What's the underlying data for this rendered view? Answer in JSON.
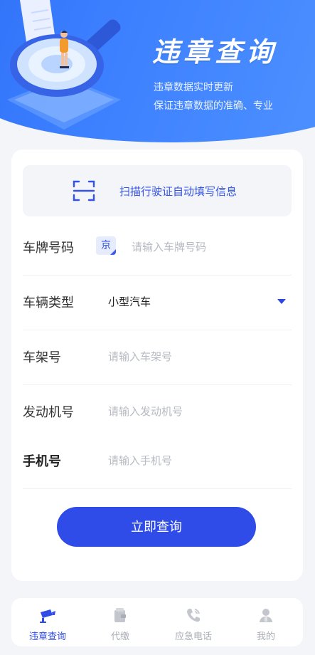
{
  "banner": {
    "title": "违章查询",
    "subtitle_line1": "违章数据实时更新",
    "subtitle_line2": "保证违章数据的准确、专业"
  },
  "scan": {
    "label": "扫描行驶证自动填写信息",
    "icon": "scan-icon"
  },
  "form": {
    "plate": {
      "label": "车牌号码",
      "prefix": "京",
      "placeholder": "请输入车牌号码"
    },
    "vehicle_type": {
      "label": "车辆类型",
      "value": "小型汽车",
      "icon": "dropdown-arrow-icon"
    },
    "frame_no": {
      "label": "车架号",
      "placeholder": "请输入车架号"
    },
    "engine_no": {
      "label": "发动机号",
      "placeholder": "请输入发动机号"
    },
    "phone": {
      "label": "手机号",
      "placeholder": "请输入手机号"
    },
    "submit_label": "立即查询"
  },
  "tabs": [
    {
      "label": "违章查询",
      "icon": "camera-icon",
      "active": true
    },
    {
      "label": "代缴",
      "icon": "wallet-icon",
      "active": false
    },
    {
      "label": "应急电话",
      "icon": "phone-icon",
      "active": false
    },
    {
      "label": "我的",
      "icon": "user-icon",
      "active": false
    }
  ],
  "colors": {
    "primary": "#2f4be8",
    "banner_gradient_start": "#2b6cf6",
    "banner_gradient_end": "#4f93ff",
    "placeholder": "#b6bac2",
    "inactive_tab": "#a9adb5"
  }
}
